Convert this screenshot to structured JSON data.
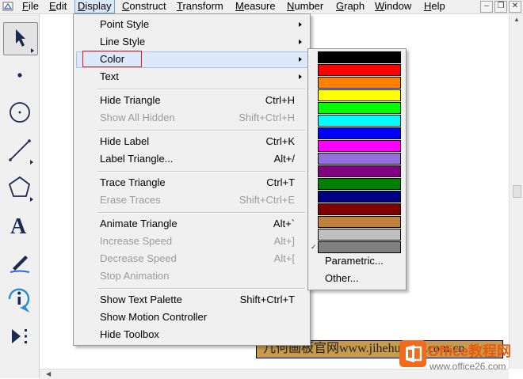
{
  "menubar": {
    "items": [
      {
        "pre": "",
        "u": "F",
        "post": "ile"
      },
      {
        "pre": "",
        "u": "E",
        "post": "dit"
      },
      {
        "pre": "",
        "u": "D",
        "post": "isplay"
      },
      {
        "pre": "",
        "u": "C",
        "post": "onstruct"
      },
      {
        "pre": "",
        "u": "T",
        "post": "ransform"
      },
      {
        "pre": "",
        "u": "M",
        "post": "easure"
      },
      {
        "pre": "",
        "u": "N",
        "post": "umber"
      },
      {
        "pre": "",
        "u": "G",
        "post": "raph"
      },
      {
        "pre": "",
        "u": "W",
        "post": "indow"
      },
      {
        "pre": "",
        "u": "H",
        "post": "elp"
      }
    ],
    "active_index": 2
  },
  "display_menu": {
    "items": [
      {
        "label": "Point Style",
        "shortcut": "",
        "submenu": true,
        "disabled": false
      },
      {
        "label": "Line Style",
        "shortcut": "",
        "submenu": true,
        "disabled": false
      },
      {
        "label": "Color",
        "shortcut": "",
        "submenu": true,
        "disabled": false
      },
      {
        "label": "Text",
        "shortcut": "",
        "submenu": true,
        "disabled": false
      },
      {
        "label": "Hide Triangle",
        "shortcut": "Ctrl+H",
        "submenu": false,
        "disabled": false
      },
      {
        "label": "Show All Hidden",
        "shortcut": "Shift+Ctrl+H",
        "submenu": false,
        "disabled": true
      },
      {
        "label": "Hide Label",
        "shortcut": "Ctrl+K",
        "submenu": false,
        "disabled": false
      },
      {
        "label": "Label Triangle...",
        "shortcut": "Alt+/",
        "submenu": false,
        "disabled": false
      },
      {
        "label": "Trace Triangle",
        "shortcut": "Ctrl+T",
        "submenu": false,
        "disabled": false
      },
      {
        "label": "Erase Traces",
        "shortcut": "Shift+Ctrl+E",
        "submenu": false,
        "disabled": true
      },
      {
        "label": "Animate Triangle",
        "shortcut": "Alt+`",
        "submenu": false,
        "disabled": false
      },
      {
        "label": "Increase Speed",
        "shortcut": "Alt+]",
        "submenu": false,
        "disabled": true
      },
      {
        "label": "Decrease Speed",
        "shortcut": "Alt+[",
        "submenu": false,
        "disabled": true
      },
      {
        "label": "Stop Animation",
        "shortcut": "",
        "submenu": false,
        "disabled": true
      },
      {
        "label": "Show Text Palette",
        "shortcut": "Shift+Ctrl+T",
        "submenu": false,
        "disabled": false
      },
      {
        "label": "Show Motion Controller",
        "shortcut": "",
        "submenu": false,
        "disabled": false
      },
      {
        "label": "Hide Toolbox",
        "shortcut": "",
        "submenu": false,
        "disabled": false
      }
    ],
    "highlighted_index": 2
  },
  "color_menu": {
    "swatches": [
      "#000000",
      "#ff0000",
      "#ff8000",
      "#ffff00",
      "#00ff00",
      "#00ffff",
      "#0000ff",
      "#ff00ff",
      "#9370db",
      "#800080",
      "#008000",
      "#000080",
      "#800000",
      "#c08040",
      "#c0c0c0",
      "#808080"
    ],
    "checked_index": 15,
    "items": [
      "Parametric...",
      "Other..."
    ]
  },
  "toolbox": {
    "tools": [
      "arrow-select-icon",
      "point-icon",
      "compass-circle-icon",
      "straightedge-line-icon",
      "polygon-icon",
      "text-tool-icon",
      "marker-icon",
      "information-icon",
      "custom-tool-icon"
    ],
    "selected_index": 0
  },
  "canvas": {
    "text_object": "几何画板官网www.jihehuaban.com.cn"
  },
  "watermark": {
    "title": "Office教程网",
    "url": "www.office26.com"
  },
  "window_controls": [
    "minimize-icon",
    "restore-icon",
    "close-icon"
  ],
  "colors": {
    "menu_bg": "#f0f0f0",
    "highlight_bg": "#dce9f8",
    "highlight_border": "#a7c4e8",
    "annotation_red": "#e02020",
    "text_box_bg": "#c89a4c",
    "watermark_orange": "#e85a10"
  }
}
